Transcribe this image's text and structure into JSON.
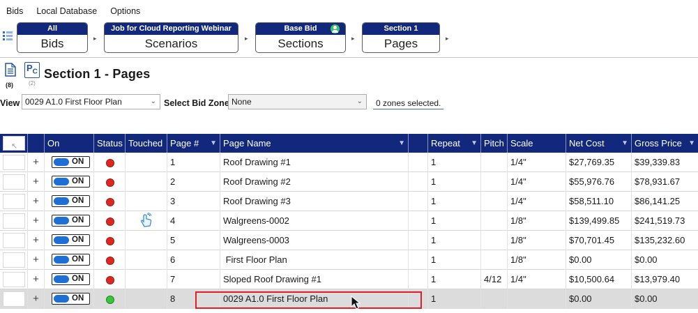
{
  "menu": [
    "Bids",
    "Local Database",
    "Options"
  ],
  "breadcrumbs": [
    {
      "top": "All",
      "label": "Bids"
    },
    {
      "top": "Job for Cloud Reporting Webinar",
      "label": "Scenarios"
    },
    {
      "top": "Base Bid",
      "label": "Sections"
    },
    {
      "top": "Section 1",
      "label": "Pages"
    }
  ],
  "header": {
    "doc_count": "(8)",
    "pc_label": "P",
    "pc_sub": "C",
    "pc_count": "(2)",
    "title": "Section 1 - Pages"
  },
  "filters": {
    "view_label": "View",
    "view_value": "0029 A1.0 First Floor Plan",
    "zone_label": "Select Bid Zone",
    "zone_value": "None",
    "zones_selected": "0 zones selected."
  },
  "columns": [
    "On",
    "Status",
    "Touched",
    "Page #",
    "Page Name",
    "Repeat",
    "Pitch",
    "Scale",
    "Net Cost",
    "Gross Price"
  ],
  "rows": [
    {
      "on": "ON",
      "status": "red",
      "touched": false,
      "page": "1",
      "name": "Roof Drawing #1",
      "repeat": "1",
      "pitch": "",
      "scale": "1/4\"",
      "net": "$27,769.35",
      "gross": "$39,339.83"
    },
    {
      "on": "ON",
      "status": "red",
      "touched": false,
      "page": "2",
      "name": "Roof Drawing #2",
      "repeat": "1",
      "pitch": "",
      "scale": "1/4\"",
      "net": "$55,976.76",
      "gross": "$78,931.67"
    },
    {
      "on": "ON",
      "status": "red",
      "touched": false,
      "page": "3",
      "name": "Roof Drawing #3",
      "repeat": "1",
      "pitch": "",
      "scale": "1/4\"",
      "net": "$58,511.10",
      "gross": "$86,141.25"
    },
    {
      "on": "ON",
      "status": "red",
      "touched": true,
      "page": "4",
      "name": "Walgreens-0002",
      "repeat": "1",
      "pitch": "",
      "scale": "1/8\"",
      "net": "$139,499.85",
      "gross": "$241,519.73"
    },
    {
      "on": "ON",
      "status": "red",
      "touched": false,
      "page": "5",
      "name": "Walgreens-0003",
      "repeat": "1",
      "pitch": "",
      "scale": "1/8\"",
      "net": "$70,701.45",
      "gross": "$135,232.60"
    },
    {
      "on": "ON",
      "status": "red",
      "touched": false,
      "page": "6",
      "name": " First Floor Plan",
      "repeat": "1",
      "pitch": "",
      "scale": "1/8\"",
      "net": "$0.00",
      "gross": "$0.00"
    },
    {
      "on": "ON",
      "status": "red",
      "touched": false,
      "page": "7",
      "name": "Sloped Roof Drawing #1",
      "repeat": "1",
      "pitch": "4/12",
      "scale": "1/4\"",
      "net": "$10,500.64",
      "gross": "$13,979.40"
    },
    {
      "on": "ON",
      "status": "green",
      "touched": false,
      "page": "8",
      "name": "0029 A1.0 First Floor Plan",
      "repeat": "1",
      "pitch": "",
      "scale": "",
      "net": "$0.00",
      "gross": "$0.00"
    }
  ],
  "selected_row": 7,
  "colors": {
    "navy": "#12287c",
    "toggle_blue": "#1d6fd6",
    "status_red": "#e0271f",
    "status_green": "#39c43b",
    "highlight_red": "#e11d2a"
  }
}
